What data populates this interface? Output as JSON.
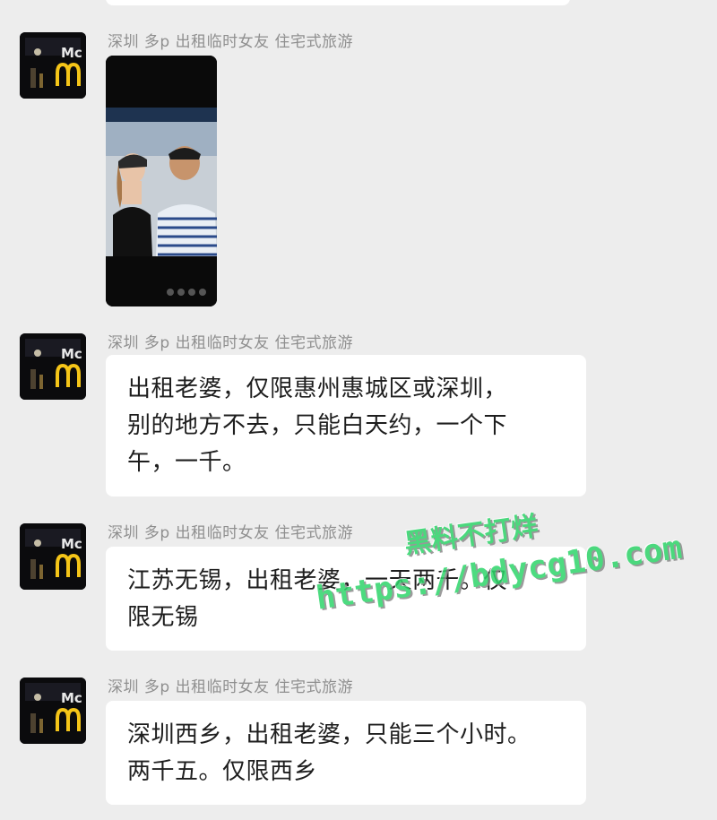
{
  "sender_name": "深圳 多p 出租临时女友 住宅式旅游",
  "messages": [
    {
      "type": "video",
      "media": "video-call-screenshot",
      "controls": [
        "mute-icon",
        "camera-icon",
        "video-icon",
        "hangup-icon"
      ]
    },
    {
      "type": "text",
      "lines": [
        "出租老婆，仅限惠州惠城区或深圳，",
        "别的地方不去，只能白天约，一个下",
        "午，一千。"
      ]
    },
    {
      "type": "text",
      "lines": [
        "江苏无锡，出租老婆，一天两千。仅",
        "限无锡"
      ]
    },
    {
      "type": "text",
      "lines": [
        "深圳西乡，出租老婆，只能三个小时。",
        "两千五。仅限西乡"
      ]
    }
  ],
  "watermark": {
    "line1": "黑料不打烊",
    "line2": "https://bdycg10.com",
    "color": "#2fd56a"
  },
  "colors": {
    "background": "#ededed",
    "bubble": "#ffffff",
    "sender_text": "#8f8f8f",
    "message_text": "#1e1e1e"
  }
}
